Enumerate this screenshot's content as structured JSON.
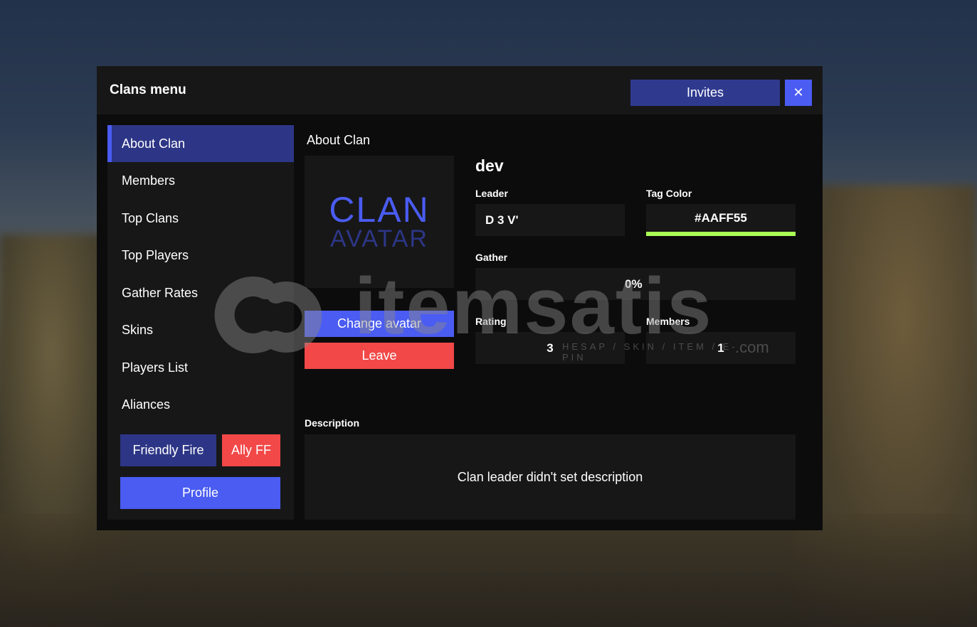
{
  "window": {
    "title": "Clans menu",
    "invites_label": "Invites",
    "close_glyph": "✕"
  },
  "sidebar": {
    "items": [
      {
        "label": "About Clan",
        "active": true
      },
      {
        "label": "Members",
        "active": false
      },
      {
        "label": "Top Clans",
        "active": false
      },
      {
        "label": "Top Players",
        "active": false
      },
      {
        "label": "Gather Rates",
        "active": false
      },
      {
        "label": "Skins",
        "active": false
      },
      {
        "label": "Players List",
        "active": false
      },
      {
        "label": "Aliances",
        "active": false
      }
    ],
    "friendly_fire_label": "Friendly Fire",
    "ally_ff_label": "Ally FF",
    "profile_label": "Profile"
  },
  "content": {
    "section_title": "About Clan",
    "avatar_line1": "CLAN",
    "avatar_line2": "AVATAR",
    "change_avatar_label": "Change avatar",
    "leave_label": "Leave",
    "clan_name": "dev",
    "leader_label": "Leader",
    "leader_value": "D 3 V'",
    "tag_color_label": "Tag Color",
    "tag_color_value": "#AAFF55",
    "gather_label": "Gather",
    "gather_value": "0%",
    "rating_label": "Rating",
    "rating_value": "3",
    "members_label": "Members",
    "members_value": "1",
    "description_label": "Description",
    "description_text": "Clan leader didn't set description"
  },
  "watermark": {
    "brand": "itemsatis",
    "tagline": "HESAP / SKIN / ITEM / E-PIN",
    "suffix": ".com"
  },
  "colors": {
    "accent": "#4a5cf2",
    "accent_dark": "#2d3686",
    "danger": "#f24848",
    "tag": "#aaff55",
    "panel": "#171717",
    "window_bg": "#0c0c0c"
  }
}
